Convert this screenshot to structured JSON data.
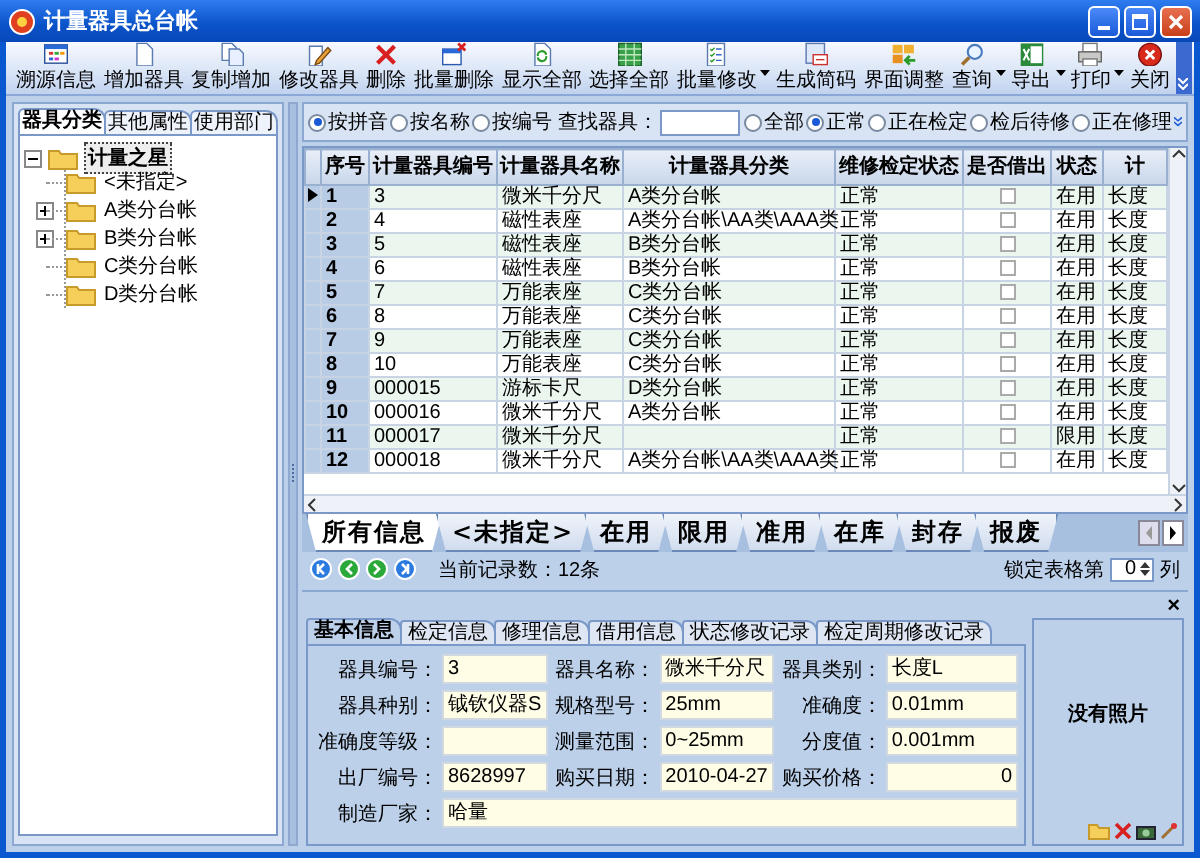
{
  "window": {
    "title": "计量器具总台帐"
  },
  "toolbar": {
    "buttons": [
      {
        "label": "溯源信息",
        "has_menu": false
      },
      {
        "label": "增加器具",
        "has_menu": false
      },
      {
        "label": "复制增加",
        "has_menu": false
      },
      {
        "label": "修改器具",
        "has_menu": false
      },
      {
        "label": "删除",
        "has_menu": false
      },
      {
        "label": "批量删除",
        "has_menu": false
      },
      {
        "label": "显示全部",
        "has_menu": false
      },
      {
        "label": "选择全部",
        "has_menu": false
      },
      {
        "label": "批量修改",
        "has_menu": true
      },
      {
        "label": "生成简码",
        "has_menu": false
      },
      {
        "label": "界面调整",
        "has_menu": false
      },
      {
        "label": "查询",
        "has_menu": true
      },
      {
        "label": "导出",
        "has_menu": true
      },
      {
        "label": "打印",
        "has_menu": true
      },
      {
        "label": "关闭",
        "has_menu": false
      }
    ]
  },
  "left_panel": {
    "tabs": [
      {
        "label": "器具分类",
        "selected": true
      },
      {
        "label": "其他属性",
        "selected": false
      },
      {
        "label": "使用部门",
        "selected": false
      }
    ],
    "tree": {
      "label": "计量之星",
      "expanded": true,
      "selected": true,
      "children": [
        {
          "label": "<未指定>",
          "kind": "leaf",
          "selected": false
        },
        {
          "label": "A类分台帐",
          "kind": "branch",
          "expanded": false,
          "selected": false
        },
        {
          "label": "B类分台帐",
          "kind": "branch",
          "expanded": false,
          "selected": false
        },
        {
          "label": "C类分台帐",
          "kind": "leaf",
          "selected": false
        },
        {
          "label": "D类分台帐",
          "kind": "leaf",
          "selected": false
        }
      ]
    }
  },
  "filter_bar": {
    "search_modes": [
      {
        "label": "按拼音",
        "selected": true
      },
      {
        "label": "按名称",
        "selected": false
      },
      {
        "label": "按编号",
        "selected": false
      }
    ],
    "search_label": "查找器具：",
    "status_filters": [
      {
        "label": "全部",
        "selected": false
      },
      {
        "label": "正常",
        "selected": true
      },
      {
        "label": "正在检定",
        "selected": false
      },
      {
        "label": "检后待修",
        "selected": false
      },
      {
        "label": "正在修理",
        "selected": false
      }
    ]
  },
  "grid": {
    "columns": [
      {
        "label": "序号",
        "kind": "text"
      },
      {
        "label": "计量器具编号",
        "kind": "text"
      },
      {
        "label": "计量器具名称",
        "kind": "text"
      },
      {
        "label": "计量器具分类",
        "kind": "text"
      },
      {
        "label": "维修检定状态",
        "kind": "text"
      },
      {
        "label": "是否借出",
        "kind": "check"
      },
      {
        "label": "状态",
        "kind": "text"
      },
      {
        "label": "计",
        "kind": "text"
      }
    ],
    "rows": [
      {
        "current": true,
        "lent": false,
        "cells": [
          "1",
          "3",
          "微米千分尺",
          "A类分台帐",
          "正常",
          "",
          "在用",
          "长度"
        ]
      },
      {
        "current": false,
        "lent": false,
        "cells": [
          "2",
          "4",
          "磁性表座",
          "A类分台帐\\AA类\\AAA类",
          "正常",
          "",
          "在用",
          "长度"
        ]
      },
      {
        "current": false,
        "lent": false,
        "cells": [
          "3",
          "5",
          "磁性表座",
          "B类分台帐",
          "正常",
          "",
          "在用",
          "长度"
        ]
      },
      {
        "current": false,
        "lent": false,
        "cells": [
          "4",
          "6",
          "磁性表座",
          "B类分台帐",
          "正常",
          "",
          "在用",
          "长度"
        ]
      },
      {
        "current": false,
        "lent": false,
        "cells": [
          "5",
          "7",
          "万能表座",
          "C类分台帐",
          "正常",
          "",
          "在用",
          "长度"
        ]
      },
      {
        "current": false,
        "lent": false,
        "cells": [
          "6",
          "8",
          "万能表座",
          "C类分台帐",
          "正常",
          "",
          "在用",
          "长度"
        ]
      },
      {
        "current": false,
        "lent": false,
        "cells": [
          "7",
          "9",
          "万能表座",
          "C类分台帐",
          "正常",
          "",
          "在用",
          "长度"
        ]
      },
      {
        "current": false,
        "lent": false,
        "cells": [
          "8",
          "10",
          "万能表座",
          "C类分台帐",
          "正常",
          "",
          "在用",
          "长度"
        ]
      },
      {
        "current": false,
        "lent": false,
        "cells": [
          "9",
          "000015",
          "游标卡尺",
          "D类分台帐",
          "正常",
          "",
          "在用",
          "长度"
        ]
      },
      {
        "current": false,
        "lent": false,
        "cells": [
          "10",
          "000016",
          "微米千分尺",
          "A类分台帐",
          "正常",
          "",
          "在用",
          "长度"
        ]
      },
      {
        "current": false,
        "lent": false,
        "cells": [
          "11",
          "000017",
          "微米千分尺",
          "",
          "正常",
          "",
          "限用",
          "长度"
        ]
      },
      {
        "current": false,
        "lent": false,
        "cells": [
          "12",
          "000018",
          "微米千分尺",
          "A类分台帐\\AA类\\AAA类",
          "正常",
          "",
          "在用",
          "长度"
        ]
      }
    ]
  },
  "category_tabs": [
    {
      "label": "所有信息",
      "selected": true
    },
    {
      "label": "<未指定>",
      "selected": false
    },
    {
      "label": "在用",
      "selected": false
    },
    {
      "label": "限用",
      "selected": false
    },
    {
      "label": "准用",
      "selected": false
    },
    {
      "label": "在库",
      "selected": false
    },
    {
      "label": "封存",
      "selected": false
    },
    {
      "label": "报废",
      "selected": false
    }
  ],
  "status_row": {
    "record_count": "当前记录数：12条",
    "lock_label": "锁定表格第",
    "lock_value": "0",
    "lock_unit": "列"
  },
  "detail": {
    "close": "×",
    "tabs": [
      {
        "label": "基本信息",
        "selected": true
      },
      {
        "label": "检定信息",
        "selected": false
      },
      {
        "label": "修理信息",
        "selected": false
      },
      {
        "label": "借用信息",
        "selected": false
      },
      {
        "label": "状态修改记录",
        "selected": false
      },
      {
        "label": "检定周期修改记录",
        "selected": false
      }
    ],
    "fields": [
      {
        "label": "器具编号：",
        "value": "3",
        "kind": "normal"
      },
      {
        "label": "器具名称：",
        "value": "微米千分尺",
        "kind": "normal"
      },
      {
        "label": "器具类别：",
        "value": "长度L",
        "kind": "normal"
      },
      {
        "label": "器具种别：",
        "value": "钺钦仪器S",
        "kind": "normal"
      },
      {
        "label": "规格型号：",
        "value": "25mm",
        "kind": "normal"
      },
      {
        "label": "准确度：",
        "value": "0.01mm",
        "kind": "normal"
      },
      {
        "label": "准确度等级：",
        "kind": "normal"
      },
      {
        "label": "测量范围：",
        "value": "0~25mm",
        "kind": "normal"
      },
      {
        "label": "分度值：",
        "value": "0.001mm",
        "kind": "normal"
      },
      {
        "label": "出厂编号：",
        "value": "8628997",
        "kind": "normal"
      },
      {
        "label": "购买日期：",
        "value": "2010-04-27",
        "kind": "normal"
      },
      {
        "label": "购买价格：",
        "value": "0",
        "kind": "number"
      },
      {
        "label": "制造厂家：",
        "value": "哈量",
        "kind": "wide"
      }
    ],
    "photo_text": "没有照片"
  }
}
